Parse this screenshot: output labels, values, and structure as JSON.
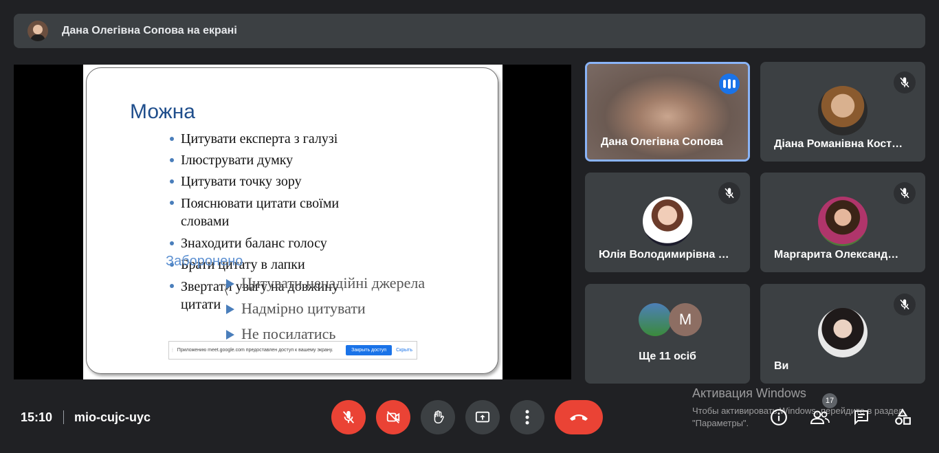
{
  "presenter_banner": {
    "text": "Дана Олегівна Сопова на екрані"
  },
  "slide": {
    "title": "Можна",
    "allowed": [
      "Цитувати експерта з галузі",
      "Ілюструвати думку",
      "Цитувати точку зору",
      "Пояснювати цитати своїми словами",
      "Знаходити баланс голосу",
      "Брати цитату в лапки",
      "Звертати увагу на довжину цитати"
    ],
    "forbidden_title": "Заборонено",
    "forbidden": [
      "Цитувати ненадійні джерела",
      "Надмірно цитувати",
      "Не посилатись"
    ],
    "share_bar": {
      "message": "Приложению meet.google.com предоставлен доступ к вашему экрану.",
      "stop_label": "Закрыть доступ",
      "hide_label": "Скрыть"
    }
  },
  "participants": [
    {
      "name": "Дана Олегівна Сопова",
      "speaking": true
    },
    {
      "name": "Діана Романівна Кост…",
      "muted": true
    },
    {
      "name": "Юлія Володимирівна …",
      "muted": true
    },
    {
      "name": "Маргарита Олександ…",
      "muted": true
    },
    {
      "name": "Ще 11 осіб",
      "avatar_letter": "M"
    },
    {
      "name": "Ви",
      "muted": true
    }
  ],
  "bottom_bar": {
    "time": "15:10",
    "meeting_code": "mio-cujc-uyc",
    "participants_count": "17",
    "controls": [
      "mic-off",
      "camera-off",
      "raise-hand",
      "present",
      "more-options",
      "leave-call"
    ],
    "right_icons": [
      "info",
      "people",
      "chat",
      "activities"
    ]
  },
  "watermark": {
    "line1": "Активация Windows",
    "line2": "Чтобы активировать Windows, перейдите в раздел \"Параметры\"."
  },
  "colors": {
    "accent": "#1a73e8",
    "danger": "#ea4335",
    "tile": "#3c4043",
    "bg": "#202124"
  }
}
